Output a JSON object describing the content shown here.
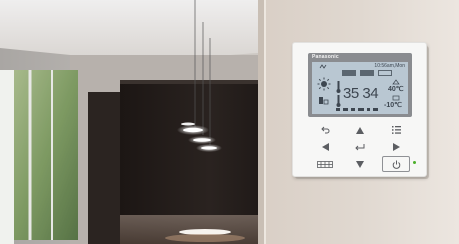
{
  "photo": {
    "subject": "wall-mounted-heat-pump-remote-controller-in-modern-interior",
    "colors": {
      "wall": "#dcd3cb",
      "window": "#6d8d4e",
      "cabinet": "#241e1c",
      "controller_body": "#f6f6f5",
      "lcd": "#b9c7d2",
      "brand_bar": "#8a8c90",
      "power_led": "#4caf2a"
    }
  },
  "controller": {
    "brand": "Panasonic",
    "lcd": {
      "date_time": "10:56am,Mon",
      "main_temp": "35 34",
      "outdoor_temp": "40℃",
      "set_temp": "-10℃"
    },
    "buttons": [
      {
        "name": "back-button",
        "icon": "back-arrow-icon"
      },
      {
        "name": "up-button",
        "icon": "up-triangle-icon"
      },
      {
        "name": "menu-button",
        "icon": "menu-list-icon"
      },
      {
        "name": "left-button",
        "icon": "left-triangle-icon"
      },
      {
        "name": "enter-button",
        "icon": "enter-icon"
      },
      {
        "name": "right-button",
        "icon": "right-triangle-icon"
      },
      {
        "name": "quick-menu-button",
        "icon": "grid-icon"
      },
      {
        "name": "down-button",
        "icon": "down-triangle-icon"
      },
      {
        "name": "power-button",
        "icon": "power-icon"
      }
    ]
  }
}
